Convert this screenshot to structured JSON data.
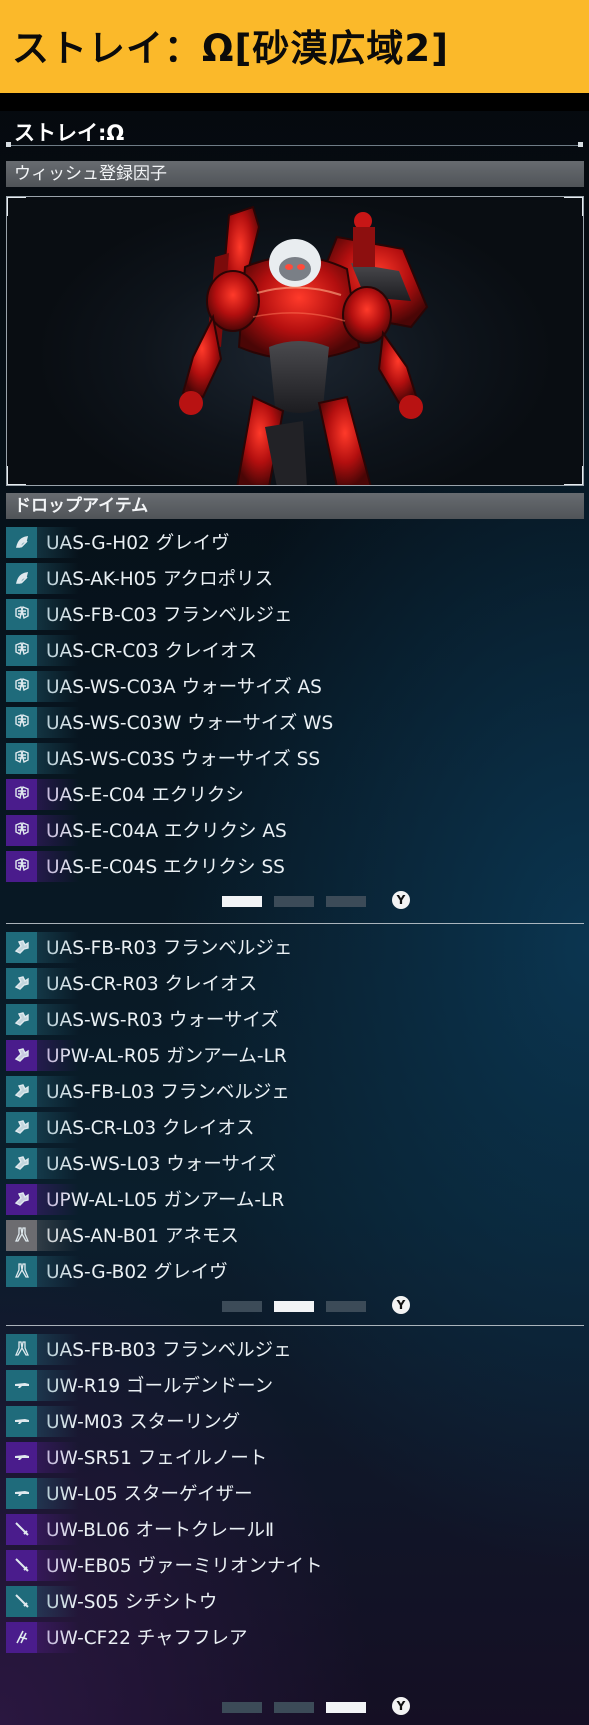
{
  "banner": {
    "title": "ストレイ：Ω[砂漠広域2]"
  },
  "boss": {
    "name": "ストレイ:Ω"
  },
  "sections": {
    "wish": "ウィッシュ登録因子",
    "drops": "ドロップアイテム"
  },
  "colors": {
    "banner": "#fbb92a",
    "teal_icon": "#1f6b7b",
    "purple_icon": "#4a1c8c",
    "gray_icon": "#6c6c70"
  },
  "pages": [
    {
      "items": [
        {
          "icon": "head-part-icon",
          "color": "teal",
          "label": "UAS-G-H02 グレイヴ"
        },
        {
          "icon": "head-part-icon",
          "color": "teal",
          "label": "UAS-AK-H05 アクロポリス"
        },
        {
          "icon": "chest-part-icon",
          "color": "teal",
          "label": "UAS-FB-C03 フランベルジェ"
        },
        {
          "icon": "chest-part-icon",
          "color": "teal",
          "label": "UAS-CR-C03 クレイオス"
        },
        {
          "icon": "chest-part-icon",
          "color": "teal",
          "label": "UAS-WS-C03A ウォーサイズ AS"
        },
        {
          "icon": "chest-part-icon",
          "color": "teal",
          "label": "UAS-WS-C03W ウォーサイズ WS"
        },
        {
          "icon": "chest-part-icon",
          "color": "teal",
          "label": "UAS-WS-C03S ウォーサイズ SS"
        },
        {
          "icon": "chest-part-icon",
          "color": "purple",
          "label": "UAS-E-C04 エクリクシ"
        },
        {
          "icon": "chest-part-icon",
          "color": "purple",
          "label": "UAS-E-C04A エクリクシ AS"
        },
        {
          "icon": "chest-part-icon",
          "color": "purple",
          "label": "UAS-E-C04S エクリクシ SS"
        }
      ],
      "active_page": 1
    },
    {
      "items": [
        {
          "icon": "arm-part-icon",
          "color": "teal",
          "label": "UAS-FB-R03 フランベルジェ"
        },
        {
          "icon": "arm-part-icon",
          "color": "teal",
          "label": "UAS-CR-R03 クレイオス"
        },
        {
          "icon": "arm-part-icon",
          "color": "teal",
          "label": "UAS-WS-R03 ウォーサイズ"
        },
        {
          "icon": "arm-part-icon",
          "color": "purple",
          "label": "UPW-AL-R05 ガンアーム-LR"
        },
        {
          "icon": "arm-part-icon",
          "color": "teal",
          "label": "UAS-FB-L03 フランベルジェ"
        },
        {
          "icon": "arm-part-icon",
          "color": "teal",
          "label": "UAS-CR-L03 クレイオス"
        },
        {
          "icon": "arm-part-icon",
          "color": "teal",
          "label": "UAS-WS-L03 ウォーサイズ"
        },
        {
          "icon": "arm-part-icon",
          "color": "purple",
          "label": "UPW-AL-L05 ガンアーム-LR"
        },
        {
          "icon": "leg-part-icon",
          "color": "gray",
          "label": "UAS-AN-B01 アネモス"
        },
        {
          "icon": "leg-part-icon",
          "color": "teal",
          "label": "UAS-G-B02 グレイヴ"
        }
      ],
      "active_page": 2
    },
    {
      "items": [
        {
          "icon": "leg-part-icon",
          "color": "teal",
          "label": "UAS-FB-B03 フランベルジェ"
        },
        {
          "icon": "gun-weapon-icon",
          "color": "teal",
          "label": "UW-R19 ゴールデンドーン"
        },
        {
          "icon": "gun-weapon-icon",
          "color": "teal",
          "label": "UW-M03 スターリング"
        },
        {
          "icon": "gun-weapon-icon",
          "color": "purple",
          "label": "UW-SR51 フェイルノート"
        },
        {
          "icon": "gun-weapon-icon",
          "color": "teal",
          "label": "UW-L05 スターゲイザー"
        },
        {
          "icon": "blade-weapon-icon",
          "color": "purple",
          "label": "UW-BL06 オートクレールⅡ"
        },
        {
          "icon": "blade-weapon-icon",
          "color": "purple",
          "label": "UW-EB05 ヴァーミリオンナイト"
        },
        {
          "icon": "blade-weapon-icon",
          "color": "teal",
          "label": "UW-S05 シチシトウ"
        },
        {
          "icon": "flare-weapon-icon",
          "color": "purple",
          "label": "UW-CF22 チャフフレア"
        }
      ],
      "active_page": 3
    }
  ],
  "pager": {
    "button_glyph": "Y",
    "page_count": 3
  }
}
